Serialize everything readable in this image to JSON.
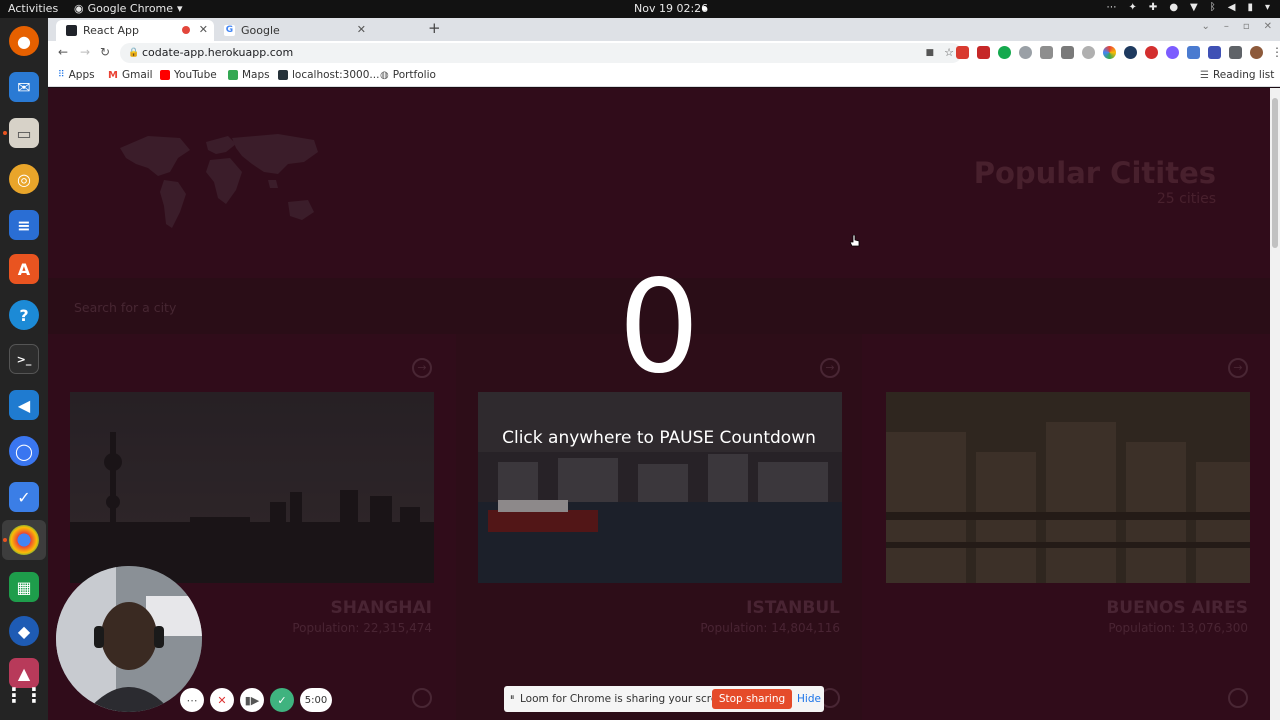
{
  "topbar": {
    "activities": "Activities",
    "app_name": "Google Chrome",
    "clock": "Nov 19  02:26"
  },
  "browser": {
    "tabs": [
      {
        "label": "React App",
        "active": true
      },
      {
        "label": "Google",
        "active": false
      }
    ],
    "url": "codate-app.herokuapp.com",
    "bookmarks": [
      {
        "label": "Apps",
        "icon": "apps-grid-icon"
      },
      {
        "label": "Gmail",
        "icon": "gmail-icon"
      },
      {
        "label": "YouTube",
        "icon": "youtube-icon"
      },
      {
        "label": "Maps",
        "icon": "maps-icon"
      },
      {
        "label": "localhost:3000...",
        "icon": "localhost-icon"
      },
      {
        "label": "Portfolio",
        "icon": "globe-icon"
      }
    ],
    "reading_list": "Reading list"
  },
  "hero": {
    "title": "Popular Citites",
    "subtitle": "25 cities"
  },
  "search": {
    "placeholder": "Search for a city"
  },
  "cities": [
    {
      "name": "SHANGHAI",
      "population": "Population: 22,315,474"
    },
    {
      "name": "ISTANBUL",
      "population": "Population: 14,804,116"
    },
    {
      "name": "BUENOS AIRES",
      "population": "Population: 13,076,300"
    }
  ],
  "overlay": {
    "countdown": "0",
    "message": "Click anywhere to PAUSE Countdown"
  },
  "loom": {
    "timer": "5:00",
    "share_message": "Loom for Chrome is sharing your screen.",
    "stop_label": "Stop sharing",
    "hide_label": "Hide"
  },
  "colors": {
    "page_bg": "#3b0f20",
    "accent_stop": "#e54b2a",
    "loom_check": "#3fb37f"
  }
}
